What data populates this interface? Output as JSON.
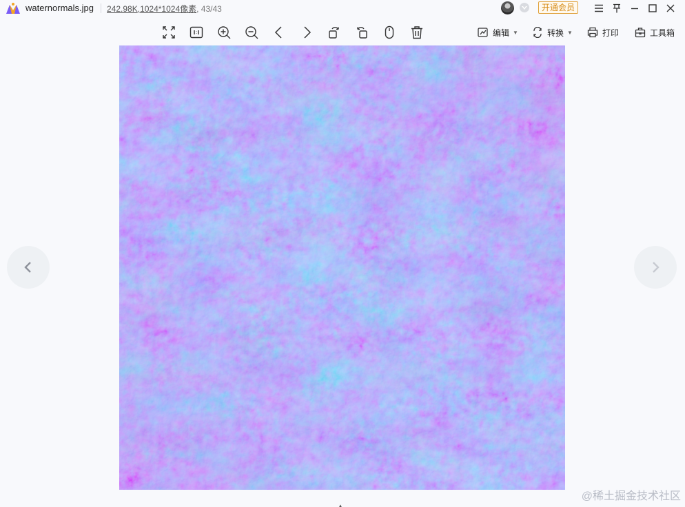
{
  "titlebar": {
    "filename": "waternormals.jpg",
    "file_size": "242.98K",
    "dimensions": "1024*1024像素",
    "separator": ",",
    "count": ", 43/43",
    "vip_label": "开通会员"
  },
  "toolbar": {
    "edit_label": "编辑",
    "convert_label": "转换",
    "print_label": "打印",
    "toolbox_label": "工具箱"
  },
  "watermark": "@稀土掘金技术社区",
  "colors": {
    "accent": "#d68a14",
    "normal_map_base": "#7d7ef4",
    "background": "#f8f9fc"
  }
}
